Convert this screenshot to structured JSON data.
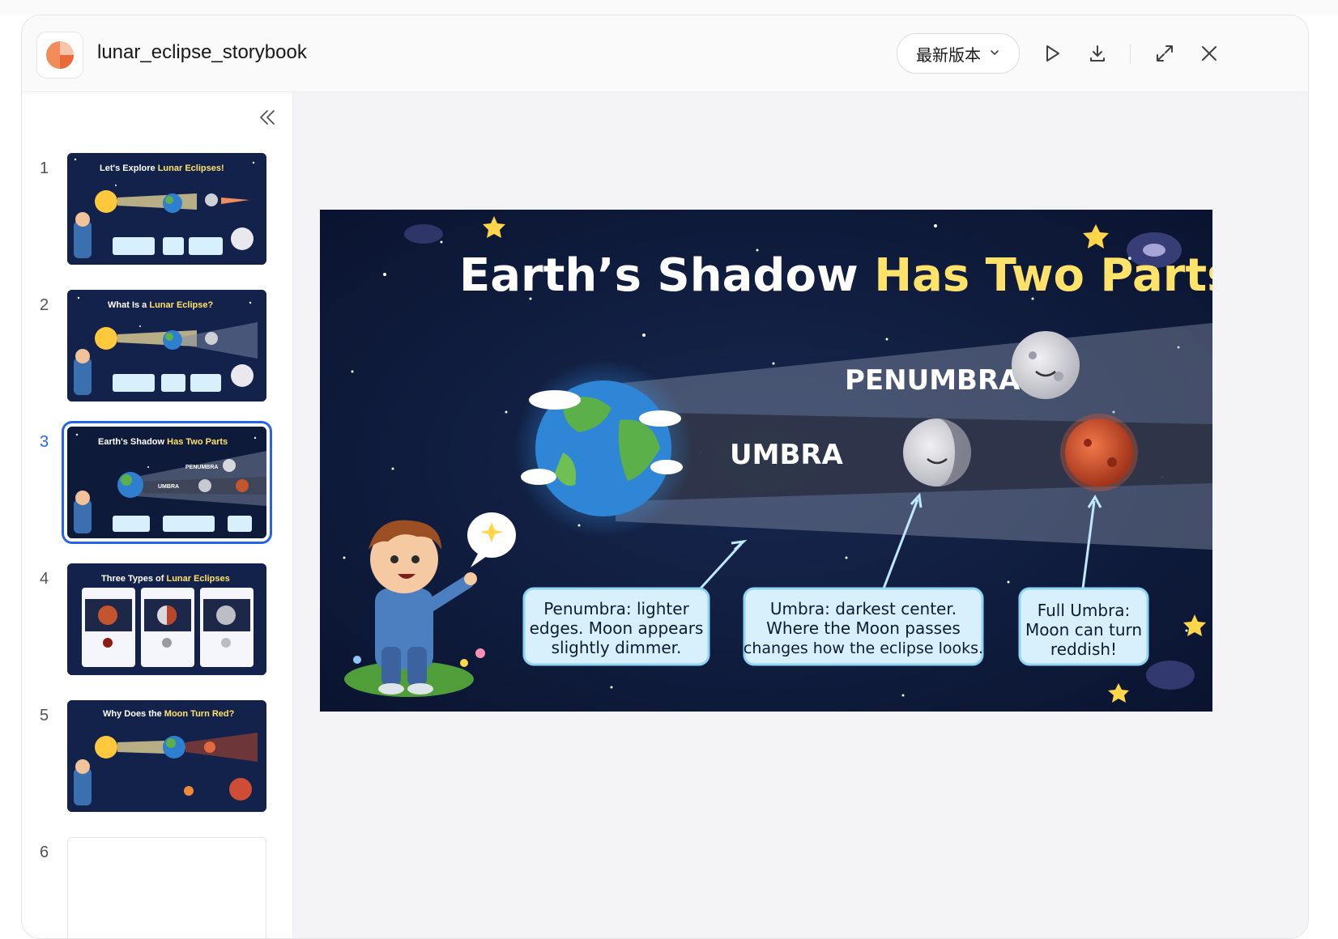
{
  "app": {
    "title": "lunar_eclipse_storybook",
    "icon": "slides-app-icon"
  },
  "header": {
    "version_label": "最新版本",
    "icons": [
      "play-icon",
      "download-icon",
      "expand-icon",
      "close-icon"
    ]
  },
  "sidebar": {
    "collapse_icon": "double-chevron-left-icon",
    "slides": [
      {
        "number": "1",
        "title_plain": "Let's Explore ",
        "title_accent": "Lunar Eclipses!"
      },
      {
        "number": "2",
        "title_plain": "What Is a ",
        "title_accent": "Lunar Eclipse?"
      },
      {
        "number": "3",
        "title_plain": "Earth's Shadow ",
        "title_accent": "Has Two Parts"
      },
      {
        "number": "4",
        "title_plain": "Three Types of ",
        "title_accent": "Lunar Eclipses"
      },
      {
        "number": "5",
        "title_plain": "Why Does the ",
        "title_accent": "Moon Turn Red?"
      },
      {
        "number": "6"
      }
    ],
    "active_index": 2
  },
  "slide": {
    "title_plain": "Earth’s Shadow ",
    "title_accent": "Has Two Parts",
    "penumbra_label": "PENUMBRA",
    "umbra_label": "UMBRA",
    "callouts": [
      {
        "line1": "Penumbra: lighter",
        "line2": "edges. Moon appears",
        "line3": "slightly dimmer."
      },
      {
        "line1": "Umbra: darkest center.",
        "line2": "Where the Moon passes",
        "line3": "changes how the eclipse looks."
      },
      {
        "line1": "Full Umbra:",
        "line2": "Moon can turn",
        "line3": "reddish!"
      }
    ]
  },
  "colors": {
    "accent": "#2563eb",
    "slide_bg": "#0e1a3a",
    "title_yellow": "#ffe26a",
    "callout_bg": "#d8f0fb"
  }
}
